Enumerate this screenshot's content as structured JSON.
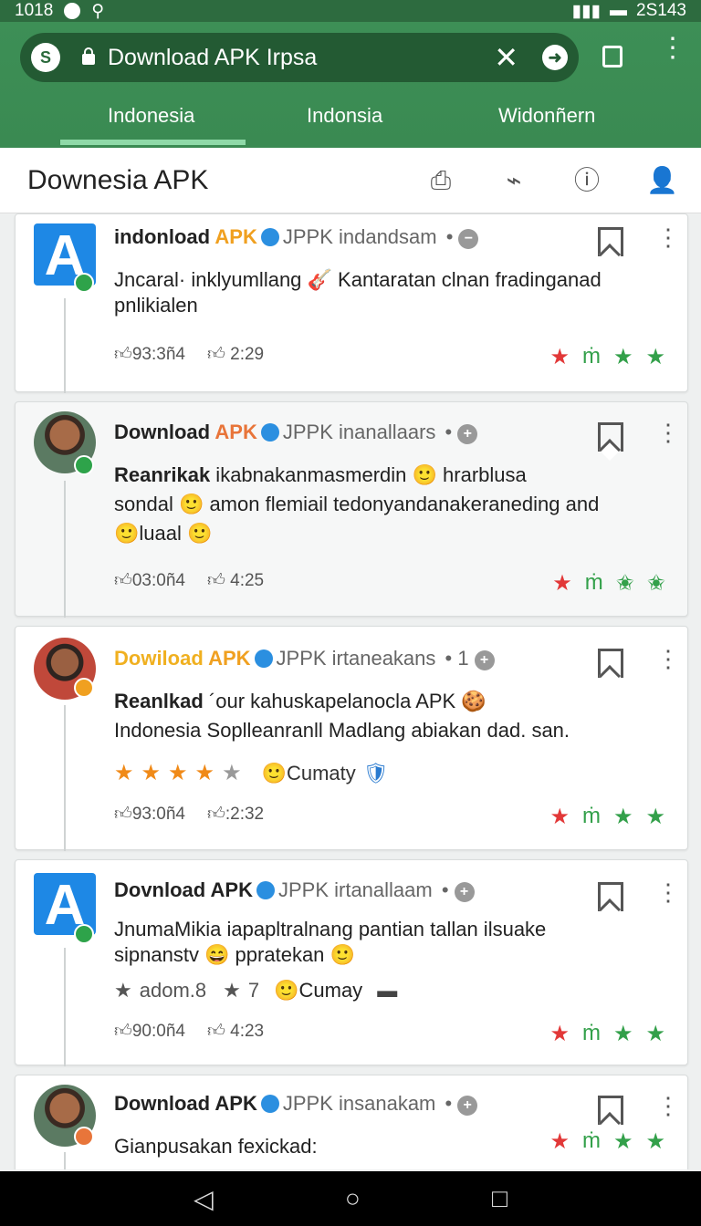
{
  "status": {
    "time": "1018",
    "right_text": "2S143"
  },
  "browser": {
    "url_text": "Download APK Irpsa",
    "tabs": [
      {
        "label": "Indonesia"
      },
      {
        "label": "Indonsia"
      },
      {
        "label": "Widonñern"
      }
    ]
  },
  "appbar": {
    "title": "Downesia APK"
  },
  "posts": [
    {
      "name_prefix": "indonload ",
      "name_highlight": "APK",
      "handle": "JPPK indandsam",
      "separator": "•",
      "body_lines": [
        "Jncaral· inklyumllang 🎸 Kantaratan clnan fradinganad",
        "pnlikialen"
      ],
      "likes": "93:3ñ4",
      "comments": "2:29"
    },
    {
      "name_prefix": "Download ",
      "name_highlight": "APK",
      "handle": "JPPK inanallaars",
      "separator": "•",
      "body_bold": "Reanrikak",
      "body_lines": [
        " ikabnakanmasmerdin 🙂 hrarblusa",
        "sondal 🙂 amon flemiail tedonyandanakeraneding and",
        "🙂luaal 🙂"
      ],
      "likes": "03:0ñ4",
      "comments": "4:25"
    },
    {
      "name_prefix": "Dowiload ",
      "name_highlight": "APK",
      "handle": "JPPK irtaneakans",
      "separator": "• 1",
      "body_bold": "Reanlkad",
      "body_lines": [
        " ´our kahuskapelanocla APK 🍪",
        "Indonesia Soplleanranll Madlang abiakan dad. san."
      ],
      "stars_label": "🙂Cumaty",
      "stars_value": 4,
      "likes": "93:0ñ4",
      "comments": ":2:32"
    },
    {
      "name_prefix": "Dovnload ",
      "name_highlight": "APK",
      "handle": "JPPK irtanallaam",
      "separator": "•",
      "body_lines": [
        "JnumaMikia iapapltralnang pantian tallan ilsuake",
        "sipnanstv 😄 ppratekan 🙂"
      ],
      "extra_a": "adom.8",
      "extra_b": "7",
      "extra_c": "🙂Cumay",
      "likes": "90:0ñ4",
      "comments": "4:23"
    },
    {
      "name_prefix": "Download ",
      "name_highlight": "APK",
      "handle": "JPPK insanakam",
      "separator": "•",
      "body_lines": [
        "Gianpusakan fexickad:"
      ]
    }
  ],
  "colors": {
    "green_header": "#3d8f56",
    "accent_blue": "#1a8fd8",
    "star_red": "#e23838",
    "star_green": "#33a04a"
  }
}
